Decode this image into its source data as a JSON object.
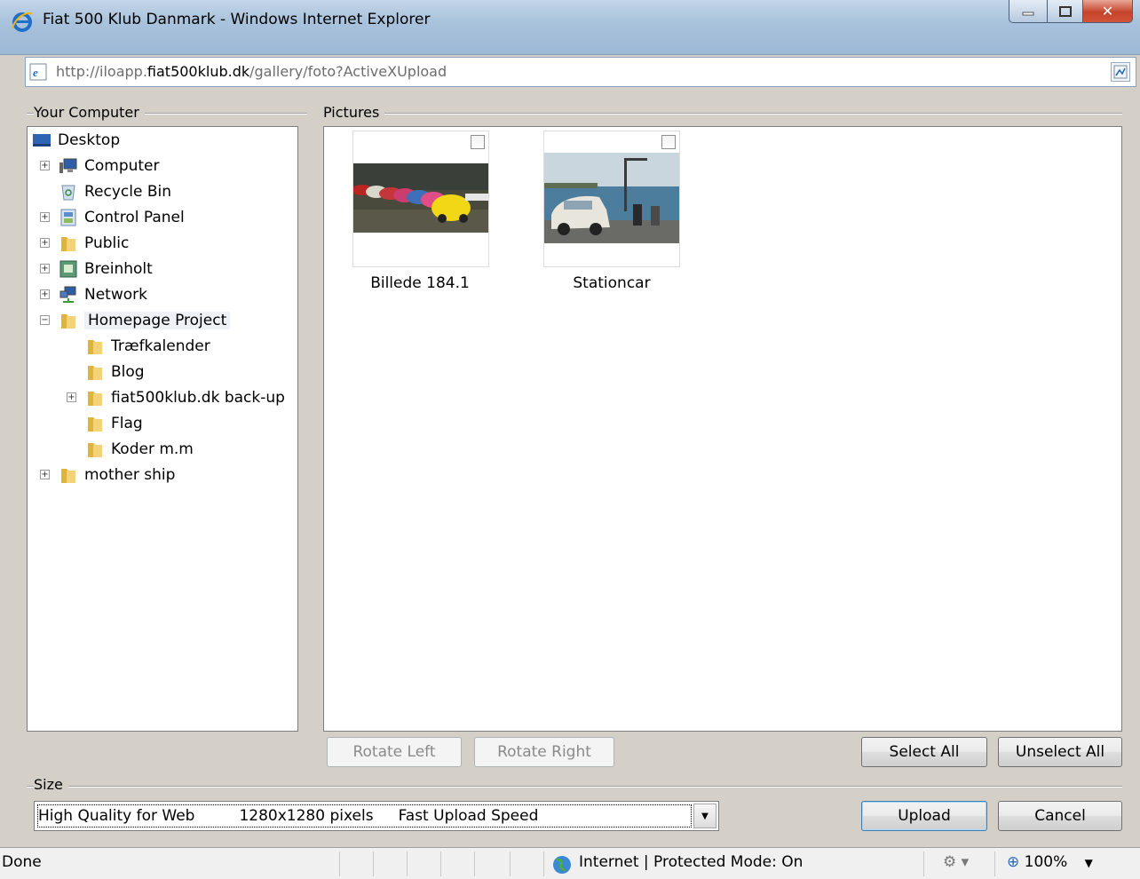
{
  "window": {
    "title": "Fiat 500 Klub Danmark - Windows Internet Explorer",
    "url_prefix": "http://iloapp.",
    "url_domain": "fiat500klub.dk",
    "url_path": "/gallery/foto?ActiveXUpload"
  },
  "left_panel": {
    "label": "Your Computer",
    "tree": [
      {
        "label": "Desktop",
        "icon": "desktop-icon",
        "level": 0,
        "expander": null
      },
      {
        "label": "Computer",
        "icon": "computer-icon",
        "level": 1,
        "expander": "+"
      },
      {
        "label": "Recycle Bin",
        "icon": "recycle-bin-icon",
        "level": 1,
        "expander": null
      },
      {
        "label": "Control Panel",
        "icon": "control-panel-icon",
        "level": 1,
        "expander": "+"
      },
      {
        "label": "Public",
        "icon": "folder-icon",
        "level": 1,
        "expander": "+"
      },
      {
        "label": "Breinholt",
        "icon": "user-folder-icon",
        "level": 1,
        "expander": "+"
      },
      {
        "label": "Network",
        "icon": "network-icon",
        "level": 1,
        "expander": "+"
      },
      {
        "label": "Homepage Project",
        "icon": "folder-icon",
        "level": 1,
        "expander": "-",
        "selected": true
      },
      {
        "label": "Træfkalender",
        "icon": "folder-icon",
        "level": 2,
        "expander": null
      },
      {
        "label": "Blog",
        "icon": "folder-icon",
        "level": 2,
        "expander": null
      },
      {
        "label": "fiat500klub.dk back-up",
        "icon": "folder-icon",
        "level": 2,
        "expander": "+"
      },
      {
        "label": "Flag",
        "icon": "folder-icon",
        "level": 2,
        "expander": null
      },
      {
        "label": "Koder m.m",
        "icon": "folder-icon",
        "level": 2,
        "expander": null
      },
      {
        "label": "mother ship",
        "icon": "folder-icon",
        "level": 1,
        "expander": "+"
      }
    ]
  },
  "pictures_panel": {
    "label": "Pictures",
    "items": [
      {
        "caption": "Billede 184.1",
        "checked": false
      },
      {
        "caption": "Stationcar",
        "checked": false
      }
    ]
  },
  "actions": {
    "rotate_left": "Rotate Left",
    "rotate_right": "Rotate Right",
    "select_all": "Select All",
    "unselect_all": "Unselect All",
    "upload": "Upload",
    "cancel": "Cancel"
  },
  "size": {
    "label": "Size",
    "selected_quality": "High Quality for Web",
    "selected_dimensions": "1280x1280 pixels",
    "selected_speed": "Fast Upload Speed"
  },
  "status": {
    "text": "Done",
    "zone": "Internet | Protected Mode: On",
    "zoom": "100%"
  },
  "colors": {
    "window_frame": "#a9c2dc",
    "panel_bg": "#d4d0c8",
    "close_button": "#c4432b"
  }
}
